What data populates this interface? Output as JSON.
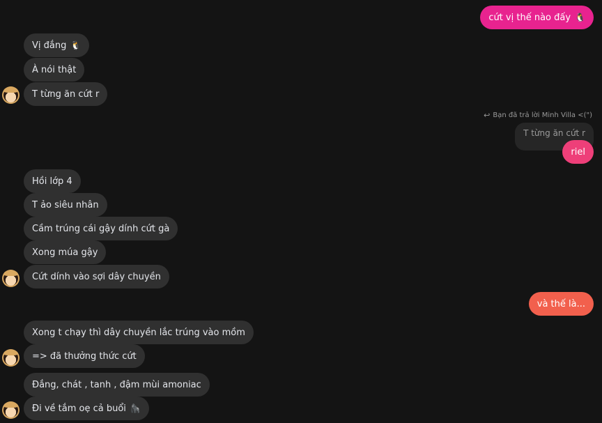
{
  "colors": {
    "background": "#141414",
    "incoming_bubble": "#303030",
    "outgoing_magenta": "#e8238f",
    "outgoing_pink": "#ee3f79",
    "outgoing_coral": "#f2604d"
  },
  "messages": [
    {
      "side": "out",
      "text": "cứt vị thế nào đấy",
      "emoji": "🐧"
    },
    {
      "side": "in",
      "text": "Vị đắng",
      "emoji": "🐧"
    },
    {
      "side": "in",
      "text": "À nói thật"
    },
    {
      "side": "in",
      "text": "T từng ăn cứt r"
    },
    {
      "side": "out",
      "text": "riel"
    },
    {
      "side": "in",
      "text": "Hồi lớp 4"
    },
    {
      "side": "in",
      "text": "T ảo siêu nhân"
    },
    {
      "side": "in",
      "text": "Cầm trúng cái gậy dính cứt gà"
    },
    {
      "side": "in",
      "text": "Xong múa gậy"
    },
    {
      "side": "in",
      "text": "Cứt dính vào sợi dây chuyền"
    },
    {
      "side": "out",
      "text": "và thế là..."
    },
    {
      "side": "in",
      "text": "Xong t chạy thì dây chuyền lắc trúng vào mồm"
    },
    {
      "side": "in",
      "text": "=> đã thưởng thức cứt"
    },
    {
      "side": "in",
      "text": "Đắng, chát , tanh , đậm mùi amoniac"
    },
    {
      "side": "in",
      "text": "Đi về tắm oẹ cả buổi",
      "emoji": "🦍"
    }
  ],
  "reply": {
    "note": "Bạn đã trả lời Minh Villa <(\")",
    "quoted_text": "T từng ăn cứt r"
  }
}
